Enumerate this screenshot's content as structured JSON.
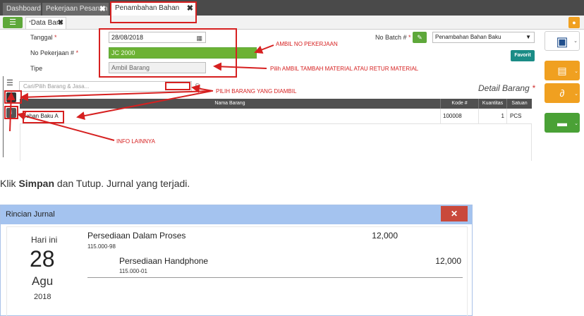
{
  "app": {
    "tabs": [
      {
        "label": "Dashboard"
      },
      {
        "label": "Pekerjaan Pesanan",
        "close": "✖"
      },
      {
        "label": "Penambahan Bahan Baku",
        "close": "✖"
      }
    ],
    "subtab": {
      "label": "Data Baru",
      "close": "✖",
      "marker": "*"
    },
    "form": {
      "tanggal_label": "Tanggal",
      "tanggal_value": "28/08/2018",
      "no_pekerjaan_label": "No Pekerjaan #",
      "no_pekerjaan_value": "JC 2000",
      "tipe_label": "Tipe",
      "tipe_value": "Ambil Barang",
      "required_mark": "*",
      "no_batch_label": "No Batch #",
      "select_value": "Penambahan Bahan Baku",
      "favorit_label": "Favorit"
    },
    "search_placeholder": "Cari/Pilih Barang & Jasa...",
    "detail_title": "Detail Barang",
    "detail_req": "*",
    "grid": {
      "headers": [
        "Nama Barang",
        "Kode #",
        "Kuantitas",
        "Satuan"
      ],
      "rows": [
        {
          "nama": "Bahan Baku A",
          "kode": "100008",
          "qty": "1",
          "satuan": "PCS"
        }
      ]
    },
    "annotations": {
      "ambil": "AMBIL NO PEKERJAAN",
      "pilih_tipe": "Pilih AMBIL TAMBAH MATERIAL ATAU RETUR MATERIAL",
      "pilih_barang": "PILIH BARANG YANG DIAMBIL",
      "info": "INFO LAINNYA"
    },
    "colors": {
      "accent_green": "#5ea83a",
      "orange": "#f0a020",
      "annotation_red": "#d62020"
    }
  },
  "caption": {
    "pre": "Klik ",
    "bold": "Simpan",
    "post": " dan Tutup. Jurnal yang terjadi."
  },
  "journal": {
    "title": "Rincian Jurnal",
    "close": "✕",
    "date": {
      "label": "Hari ini",
      "day": "28",
      "month": "Agu",
      "year": "2018"
    },
    "entries": [
      {
        "name": "Persediaan Dalam Proses",
        "code": "115.000-98",
        "amount": "12,000"
      },
      {
        "name": "Persediaan Handphone",
        "code": "115.000-01",
        "amount": "12,000"
      }
    ]
  }
}
